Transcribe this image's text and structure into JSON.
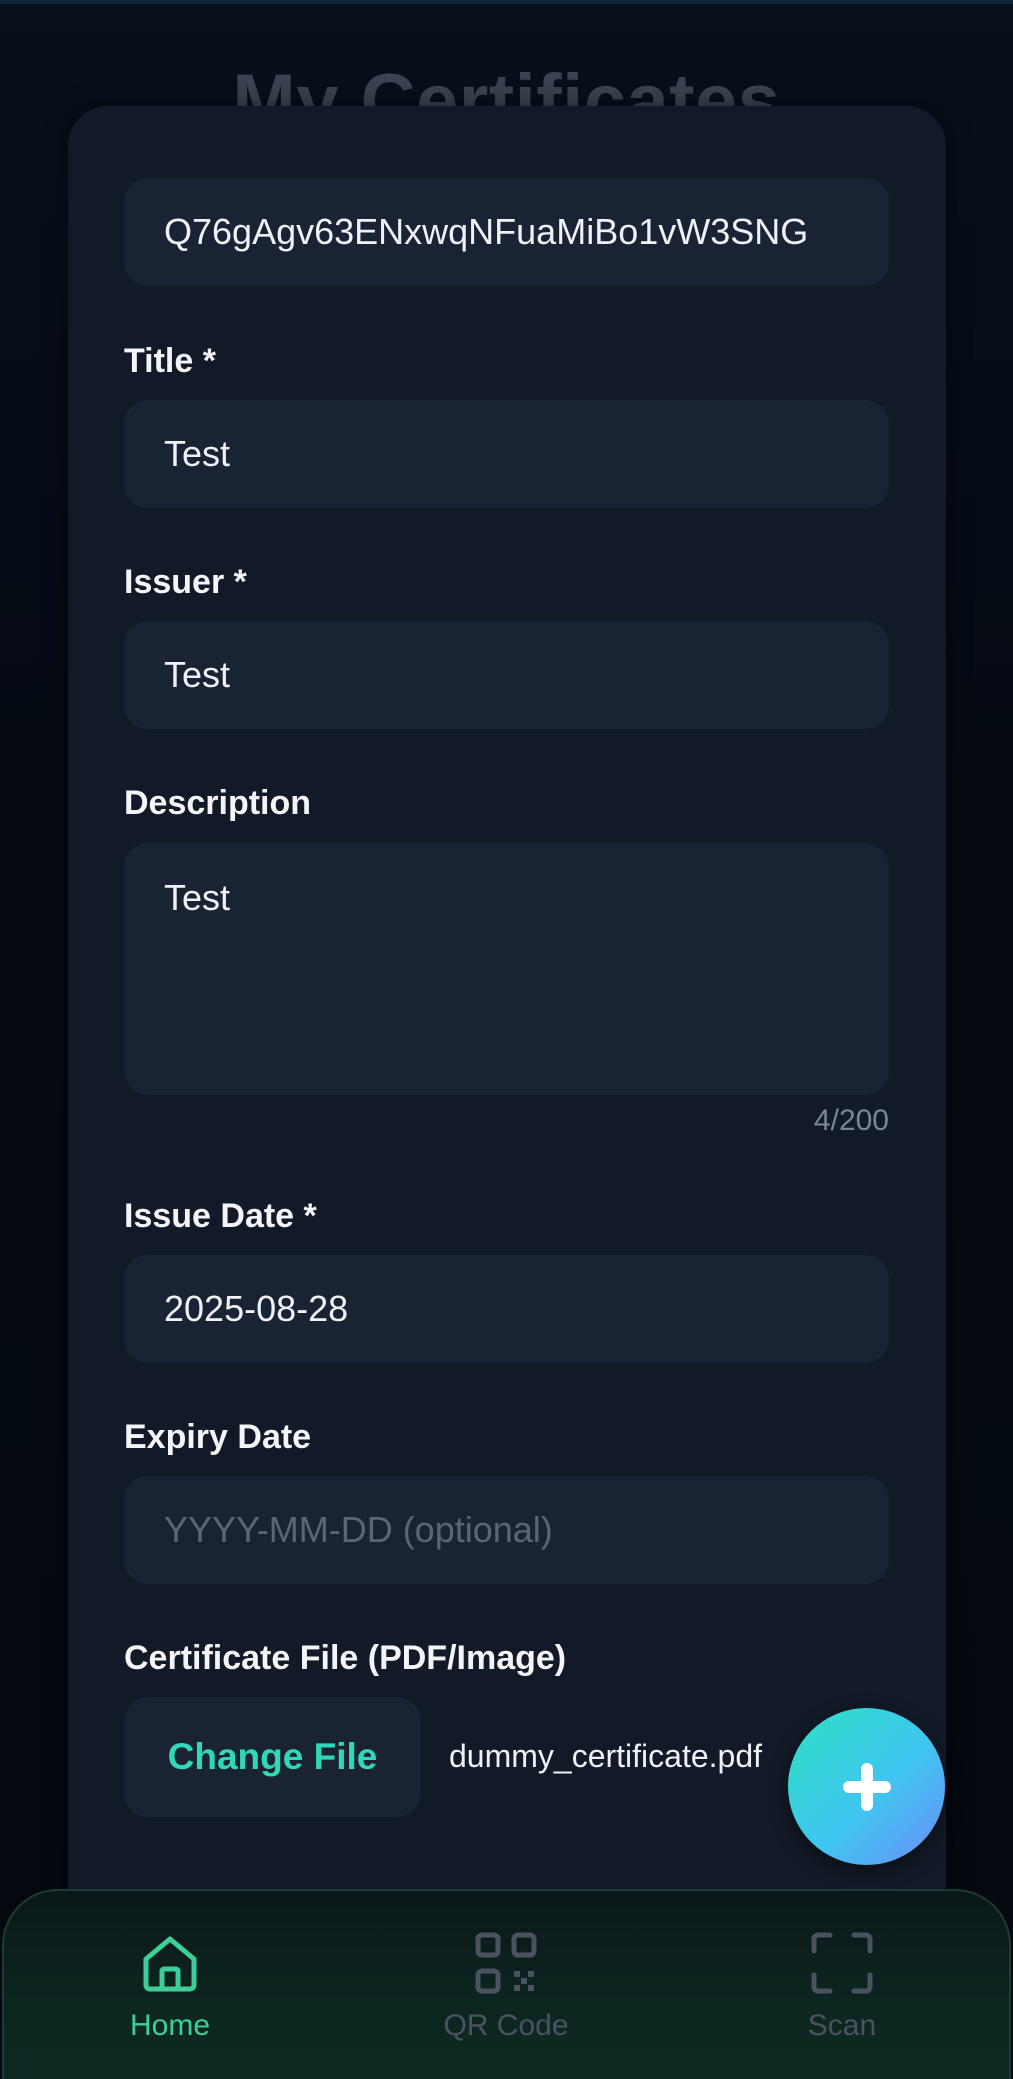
{
  "header": {
    "title": "My Certificates"
  },
  "form": {
    "id_value": "Q76gAgv63ENxwqNFuaMiBo1vW3SNG",
    "title_label": "Title *",
    "title_value": "Test",
    "issuer_label": "Issuer *",
    "issuer_value": "Test",
    "description_label": "Description",
    "description_value": "Test",
    "description_counter": "4/200",
    "issue_date_label": "Issue Date *",
    "issue_date_value": "2025-08-28",
    "expiry_date_label": "Expiry Date",
    "expiry_date_placeholder": "YYYY-MM-DD (optional)",
    "file_label": "Certificate File (PDF/Image)",
    "change_file_label": "Change File",
    "file_name": "dummy_certificate.pdf"
  },
  "fab": {
    "icon": "plus-icon"
  },
  "nav": {
    "items": [
      {
        "label": "Home",
        "icon": "home-icon",
        "active": true
      },
      {
        "label": "QR Code",
        "icon": "qr-code-icon",
        "active": false
      },
      {
        "label": "Scan",
        "icon": "scan-icon",
        "active": false
      }
    ]
  },
  "colors": {
    "accent": "#2fd8b6",
    "active_nav": "#3ccf9a",
    "inactive_nav": "#4a5260",
    "field_bg": "#1a2334",
    "sheet_bg": "#121a27"
  }
}
